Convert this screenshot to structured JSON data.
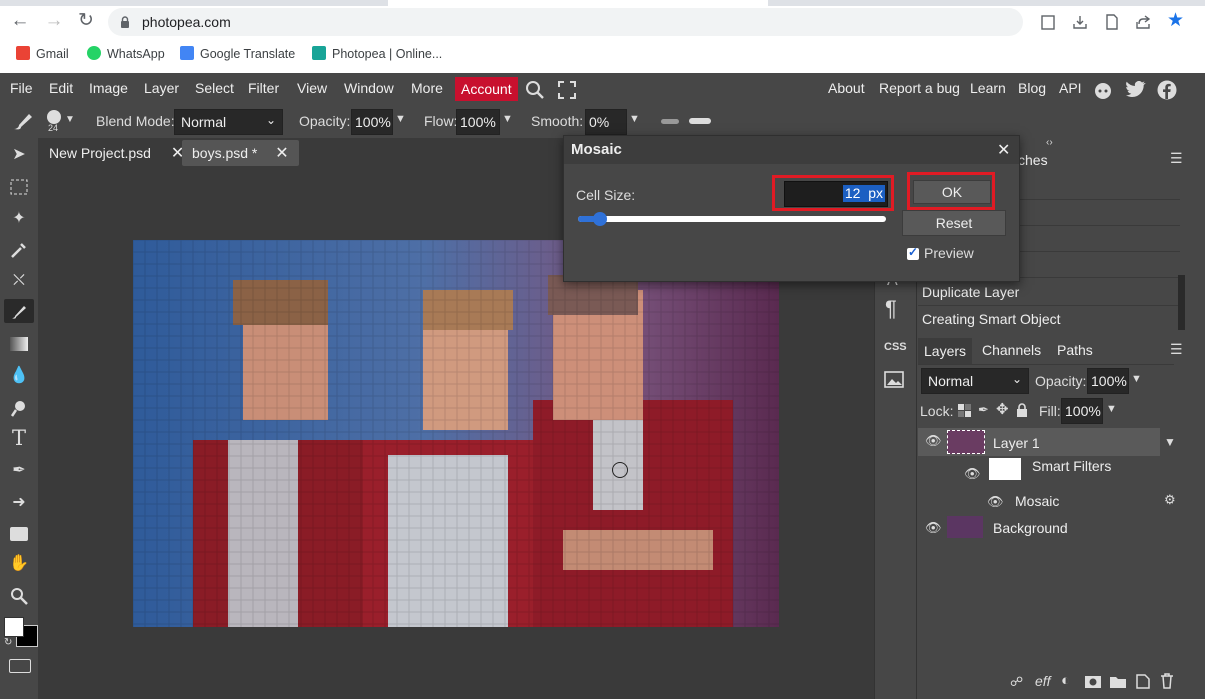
{
  "browser": {
    "url": "photopea.com",
    "bookmarks": [
      {
        "label": "Gmail",
        "color": "#ea4335"
      },
      {
        "label": "WhatsApp",
        "color": "#25d366"
      },
      {
        "label": "Google Translate",
        "color": "#4285f4"
      },
      {
        "label": "Photopea | Online...",
        "color": "#18a497"
      }
    ]
  },
  "menu": {
    "items": [
      "File",
      "Edit",
      "Image",
      "Layer",
      "Select",
      "Filter",
      "View",
      "Window",
      "More"
    ],
    "account": "Account",
    "right_items": [
      "About",
      "Report a bug",
      "Learn",
      "Blog",
      "API"
    ]
  },
  "options": {
    "brush_size": "24",
    "blend_mode_label": "Blend Mode:",
    "blend_mode": "Normal",
    "opacity_label": "Opacity:",
    "opacity": "100%",
    "flow_label": "Flow:",
    "flow": "100%",
    "smooth_label": "Smooth:",
    "smooth": "0%"
  },
  "tabs": [
    {
      "label": "New Project.psd",
      "active": false
    },
    {
      "label": "boys.psd *",
      "active": true
    }
  ],
  "history": {
    "partial_title": "ches",
    "items": [
      "Duplicate Layer",
      "Creating Smart Object"
    ]
  },
  "sidecol": {
    "css": "CSS"
  },
  "layers_panel": {
    "tabs": [
      "Layers",
      "Channels",
      "Paths"
    ],
    "blend_mode": "Normal",
    "opacity_label": "Opacity:",
    "opacity": "100%",
    "lock_label": "Lock:",
    "fill_label": "Fill:",
    "fill": "100%",
    "layers": [
      {
        "name": "Layer 1"
      },
      {
        "name": "Smart Filters"
      },
      {
        "name": "Mosaic"
      },
      {
        "name": "Background"
      }
    ],
    "footer_eff": "eff"
  },
  "dialog": {
    "title": "Mosaic",
    "cell_size_label": "Cell Size:",
    "cell_size_value": "12",
    "cell_size_unit": "px",
    "slider_fraction": 0.07,
    "ok_label": "OK",
    "reset_label": "Reset",
    "preview_label": "Preview",
    "preview_checked": true
  },
  "colors": {
    "accent_red": "#e01b24",
    "account_bg": "#c8102e",
    "link_blue": "#1a73e8"
  }
}
